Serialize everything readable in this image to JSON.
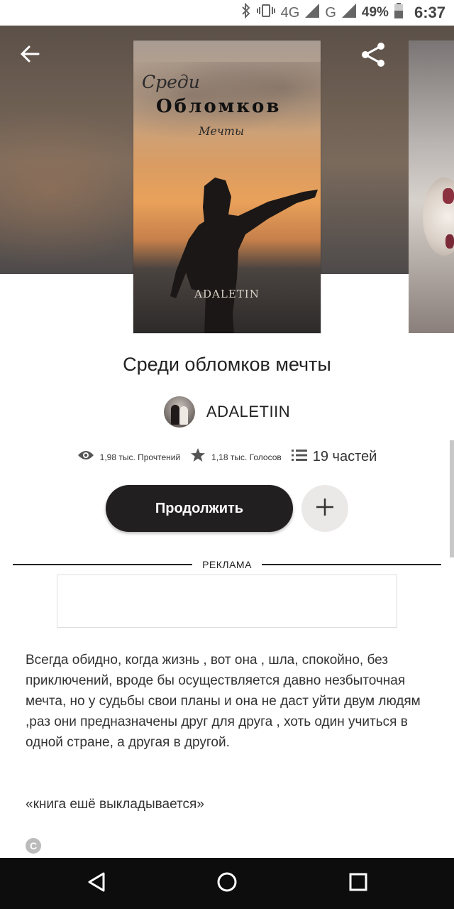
{
  "status_bar": {
    "network_4g": "4G",
    "network_g": "G",
    "battery": "49%",
    "time": "6:37"
  },
  "header": {
    "back_icon": "arrow-left-icon",
    "share_icon": "share-icon",
    "more_icon": "more-vertical-icon"
  },
  "cover": {
    "line1": "Среди",
    "line2": "Обломков",
    "line3": "Мечты",
    "author": "ADALETIN"
  },
  "book": {
    "title": "Среди обломков мечты",
    "author": "ADALETIIN"
  },
  "stats": {
    "reads": "1,98 тыс. Прочтений",
    "votes": "1,18 тыс. Голосов",
    "parts": "19 частей"
  },
  "actions": {
    "continue_label": "Продолжить",
    "add_icon": "plus-icon"
  },
  "ad": {
    "label": "РЕКЛАМА"
  },
  "description": {
    "text": "Всегда обидно, когда жизнь , вот она , шла, спокойно, без приключений, вроде бы осуществляется давно незбыточная мечта, но у судьбы свои планы и она не даст уйти двум людям  ,раз они предназначены друг для друга , хоть один учиться в одной стране, а другая в другой.",
    "note": "«книга ешё выкладывается»",
    "copyright_symbol": "C"
  },
  "nav_bar": {
    "back_icon": "nav-back-triangle-icon",
    "home_icon": "nav-home-circle-icon",
    "recents_icon": "nav-recents-square-icon"
  }
}
